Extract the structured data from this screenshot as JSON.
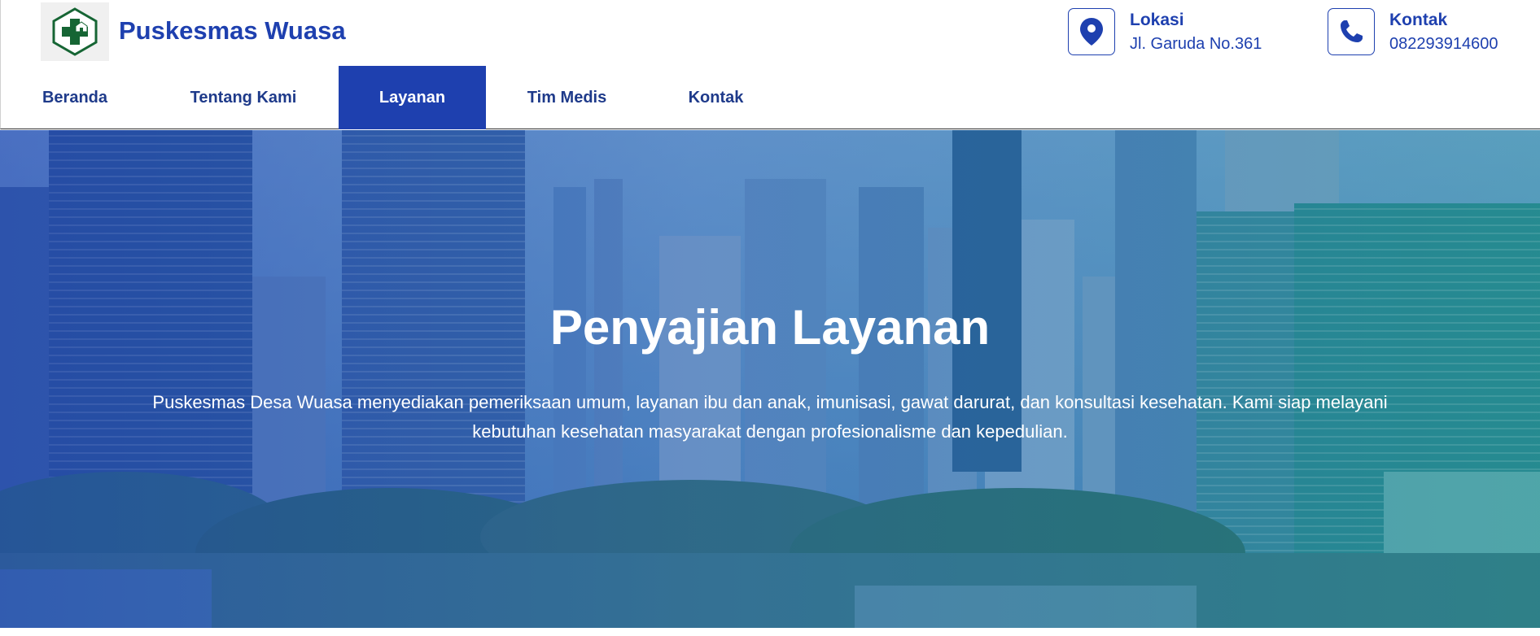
{
  "site": {
    "title": "Puskesmas Wuasa"
  },
  "header": {
    "lokasi": {
      "label": "Lokasi",
      "value": "Jl. Garuda No.361",
      "icon": "map-pin-icon"
    },
    "kontak": {
      "label": "Kontak",
      "value": "082293914600",
      "icon": "phone-icon"
    }
  },
  "nav": {
    "items": [
      {
        "label": "Beranda"
      },
      {
        "label": "Tentang Kami"
      },
      {
        "label": "Layanan",
        "active": true
      },
      {
        "label": "Tim Medis"
      },
      {
        "label": "Kontak"
      }
    ]
  },
  "hero": {
    "title": "Penyajian Layanan",
    "description": "Puskesmas Desa Wuasa menyediakan pemeriksaan umum, layanan ibu dan anak, imunisasi, gawat darurat, dan konsultasi kesehatan. Kami siap melayani kebutuhan kesehatan masyarakat dengan profesionalisme dan kepedulian."
  },
  "colors": {
    "primary": "#1e40af",
    "logo_green": "#166534"
  }
}
